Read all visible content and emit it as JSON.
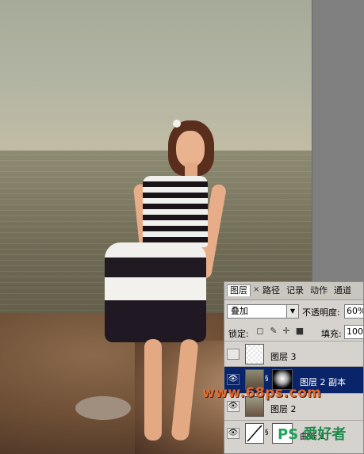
{
  "colors": {
    "panel_bg": "#d6d3ce",
    "selected_row": "#0a246a",
    "watermark_orange": "#e56b2e",
    "watermark_green": "#1fa35a"
  },
  "layers_panel": {
    "tabs": [
      {
        "label": "图层",
        "active": true
      },
      {
        "label": "路径"
      },
      {
        "label": "记录"
      },
      {
        "label": "动作"
      },
      {
        "label": "通道"
      }
    ],
    "close_glyph": "×",
    "blend_mode": "叠加",
    "opacity_label": "不透明度:",
    "opacity_value": "60%",
    "lock_label": "锁定:",
    "fill_label": "填充:",
    "fill_value": "100%",
    "layers": [
      {
        "name": "图层 3",
        "visible": false,
        "selected": false
      },
      {
        "name": "图层 2 副本",
        "visible": true,
        "selected": true,
        "has_mask": true
      },
      {
        "name": "图层 2",
        "visible": true,
        "selected": false
      },
      {
        "name": "曲线 1",
        "visible": true,
        "selected": false,
        "adjustment": true
      }
    ]
  },
  "watermarks": {
    "site": "www.68ps.com",
    "logo_text": "PS",
    "logo_suffix": "爱好者",
    "logo_url": "www.psahz.com"
  },
  "icons": {
    "eye": "eye-icon",
    "lock_transparent": "lock-transparent-icon",
    "lock_paint": "brush-icon",
    "lock_move": "move-icon",
    "lock_all": "padlock-icon",
    "link": "chain-link-icon",
    "dropdown": "chevron-down-icon"
  }
}
